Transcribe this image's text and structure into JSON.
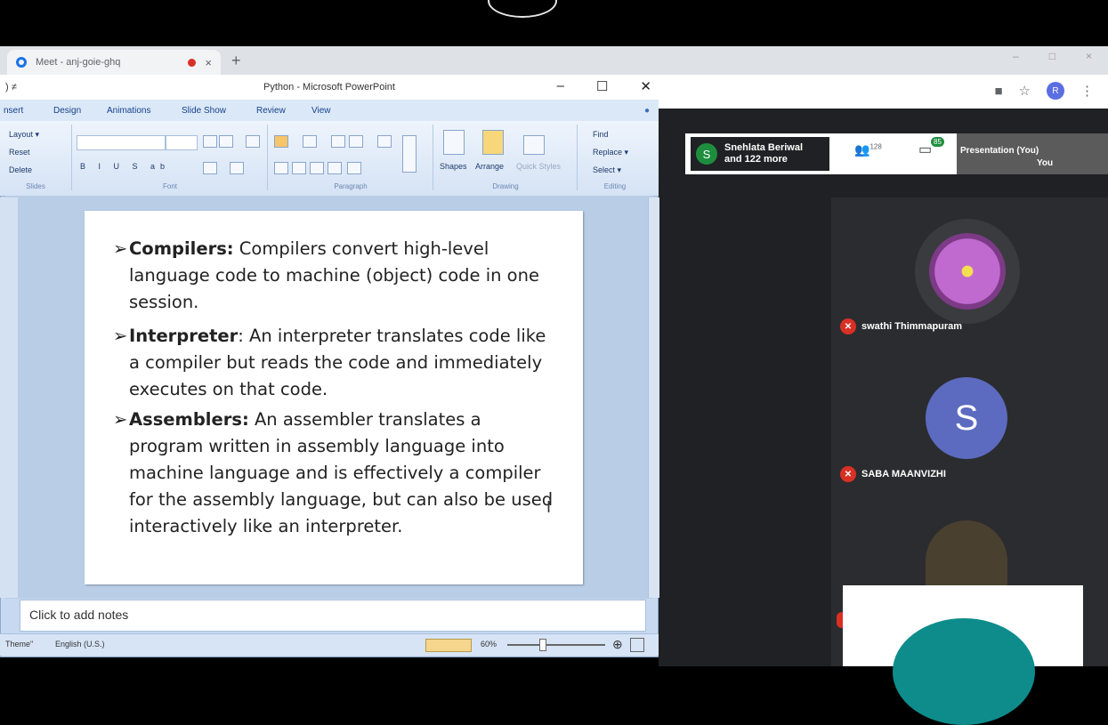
{
  "browser": {
    "tab_title": "Meet - anj-goie-ghq",
    "tab_close": "×",
    "new_tab": "+",
    "win_min": "–",
    "win_max": "□",
    "win_close": "×",
    "profile_initial": "R"
  },
  "powerpoint": {
    "title": "Python - Microsoft PowerPoint",
    "qat": ") ≠",
    "win_min": "–",
    "win_max": "☐",
    "win_close": "✕",
    "tabs": [
      "nsert",
      "Design",
      "Animations",
      "Slide Show",
      "Review",
      "View"
    ],
    "ribbon": {
      "slides": {
        "layout": "Layout ▾",
        "reset": "Reset",
        "delete": "Delete",
        "group": "Slides"
      },
      "font": {
        "group": "Font"
      },
      "paragraph": {
        "group": "Paragraph"
      },
      "drawing": {
        "shapes": "Shapes",
        "arrange": "Arrange",
        "quick_styles": "Quick Styles",
        "group": "Drawing"
      },
      "editing": {
        "find": "Find",
        "replace": "Replace ▾",
        "select": "Select ▾",
        "group": "Editing"
      }
    },
    "slide": {
      "bullets": [
        {
          "term": "Compilers:",
          "text": " Compilers convert high-level language code to machine (object) code in one session."
        },
        {
          "term": "Interpreter",
          "text": ": An interpreter translates code like a compiler but reads the code and immediately executes on that code."
        },
        {
          "term": "Assemblers:",
          "text": " An assembler translates a program written in assembly language into machine language and is effectively a compiler for the assembly language, but can also be used interactively like an interpreter."
        }
      ]
    },
    "notes_placeholder": "Click to add notes",
    "status": {
      "theme": "Theme\"",
      "language": "English (U.S.)",
      "zoom": "60%"
    }
  },
  "meet": {
    "host_initial": "S",
    "host_name": "Snehlata Beriwal",
    "host_more": "and 122 more",
    "people_count": "128",
    "chat_badge": "85",
    "presentation_label": "Presentation (You)",
    "self_label": "You",
    "participants": [
      {
        "name": "swathi Thimmapuram"
      },
      {
        "name": "SABA MAANVIZHI",
        "initial": "S"
      }
    ]
  },
  "colors": {
    "meet_bg": "#202124",
    "mute_red": "#d93025",
    "avatar_purple": "#5c6bc0",
    "host_green": "#1e8e3e"
  }
}
